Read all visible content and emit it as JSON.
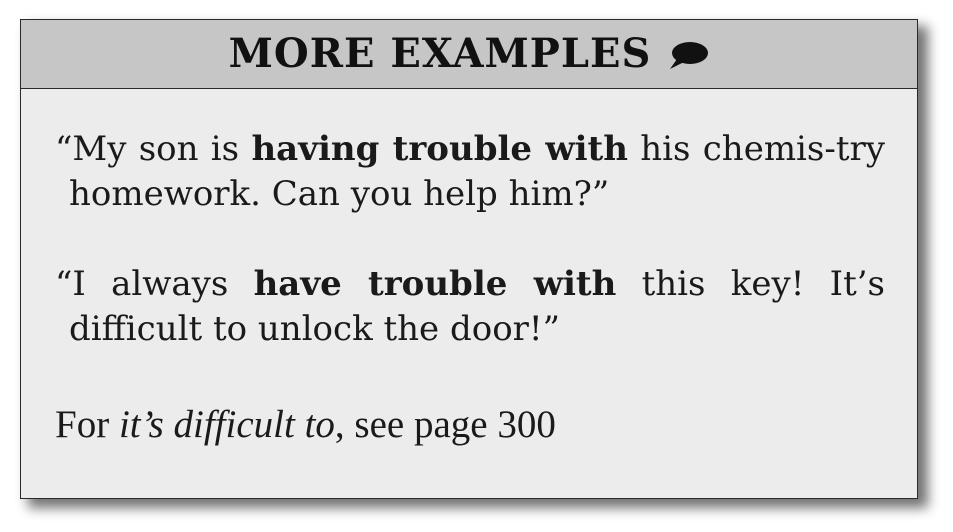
{
  "header": {
    "title": "MORE EXAMPLES",
    "icon": "speech-bubble-icon"
  },
  "examples": [
    {
      "before": "“My son is ",
      "bold": "having trouble with",
      "after": " his chemis-try homework. Can you help him?”"
    },
    {
      "before": "“I always ",
      "bold": "have trouble with",
      "after": " this key! It’s difficult to unlock the door!”"
    }
  ],
  "note": {
    "prefix": "For ",
    "italic": "it’s difficult to",
    "suffix": ", see page 300"
  }
}
